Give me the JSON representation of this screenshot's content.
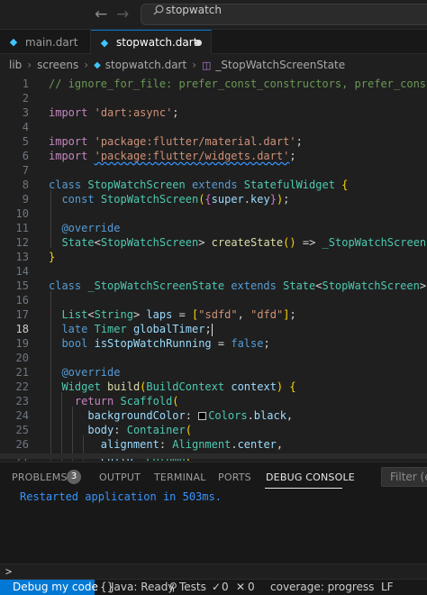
{
  "titlebar": {
    "back_icon": "arrow-left-icon",
    "forward_icon": "arrow-right-icon",
    "search_icon": "search-icon",
    "search_text": "stopwatch"
  },
  "tabs": [
    {
      "label": "main.dart",
      "icon": "dart-icon",
      "active": false
    },
    {
      "label": "stopwatch.dart",
      "icon": "dart-icon",
      "active": true,
      "unsaved": true
    }
  ],
  "breadcrumb": {
    "items": [
      "lib",
      "screens",
      "stopwatch.dart",
      "_StopWatchScreenState"
    ]
  },
  "editor": {
    "active_line": 18,
    "lines": [
      {
        "n": "1",
        "text": "// ignore_for_file: prefer_const_constructors, prefer_const_literals_to_create_immutables"
      },
      {
        "n": "2",
        "text": ""
      },
      {
        "n": "3",
        "text": "import 'dart:async';"
      },
      {
        "n": "4",
        "text": ""
      },
      {
        "n": "5",
        "text": "import 'package:flutter/material.dart';"
      },
      {
        "n": "6",
        "text": "import 'package:flutter/widgets.dart';"
      },
      {
        "n": "7",
        "text": ""
      },
      {
        "n": "8",
        "text": "class StopWatchScreen extends StatefulWidget {"
      },
      {
        "n": "9",
        "text": "  const StopWatchScreen({super.key});"
      },
      {
        "n": "10",
        "text": ""
      },
      {
        "n": "11",
        "text": "  @override"
      },
      {
        "n": "12",
        "text": "  State<StopWatchScreen> createState() => _StopWatchScreenState();"
      },
      {
        "n": "13",
        "text": "}"
      },
      {
        "n": "14",
        "text": ""
      },
      {
        "n": "15",
        "text": "class _StopWatchScreenState extends State<StopWatchScreen> {"
      },
      {
        "n": "16",
        "text": ""
      },
      {
        "n": "17",
        "text": "  List<String> laps = [\"sdfd\", \"dfd\"];"
      },
      {
        "n": "18",
        "text": "  late Timer globalTimer;"
      },
      {
        "n": "19",
        "text": "  bool isStopWatchRunning = false;"
      },
      {
        "n": "20",
        "text": ""
      },
      {
        "n": "21",
        "text": "  @override"
      },
      {
        "n": "22",
        "text": "  Widget build(BuildContext context) {"
      },
      {
        "n": "23",
        "text": "    return Scaffold("
      },
      {
        "n": "24",
        "text": "      backgroundColor: Colors.black,"
      },
      {
        "n": "25",
        "text": "      body: Container("
      },
      {
        "n": "26",
        "text": "        alignment: Alignment.center,"
      },
      {
        "n": "27",
        "text": "        child: Column("
      }
    ]
  },
  "panel": {
    "tabs": [
      {
        "label": "PROBLEMS",
        "badge": "3"
      },
      {
        "label": "OUTPUT"
      },
      {
        "label": "TERMINAL"
      },
      {
        "label": "PORTS"
      },
      {
        "label": "DEBUG CONSOLE",
        "active": true
      }
    ],
    "filter_placeholder": "Filter (e.g.",
    "console_output": "Restarted application in 503ms.",
    "prompt": ">"
  },
  "statusbar": {
    "debug": "Debug my code",
    "java_icon": "braces-icon",
    "java": "Java: Ready",
    "tests_icon": "beaker-icon",
    "tests": "Tests",
    "passed_icon": "check-icon",
    "passed": "0",
    "failed_icon": "x-icon",
    "failed": "0",
    "coverage": "coverage: progress",
    "eol": "LF"
  },
  "colors": {
    "accent": "#0078d4",
    "editor_bg": "#1f1f1f",
    "console_text": "#3794ff"
  }
}
